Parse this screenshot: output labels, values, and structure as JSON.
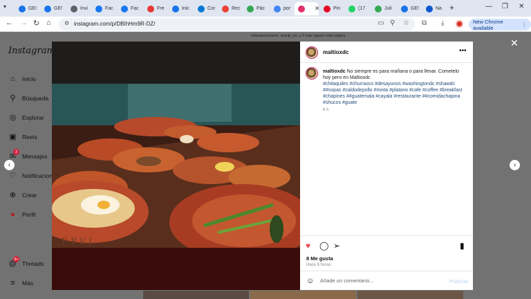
{
  "browser": {
    "tabs": [
      {
        "label": "GE!",
        "color": "#1a73e8"
      },
      {
        "label": "GE!",
        "color": "#1a73e8"
      },
      {
        "label": "Invi",
        "color": "#5f6368"
      },
      {
        "label": "Fac",
        "color": "#1877f2"
      },
      {
        "label": "Fac",
        "color": "#1877f2"
      },
      {
        "label": "Fre",
        "color": "#e53935"
      },
      {
        "label": "Inic",
        "color": "#1a73e8"
      },
      {
        "label": "Cor",
        "color": "#0078d4"
      },
      {
        "label": "Rec",
        "color": "#ea4335"
      },
      {
        "label": "Pác",
        "color": "#34a853"
      },
      {
        "label": "por",
        "color": "#4285f4"
      },
      {
        "label": "",
        "color": "#e1306c"
      },
      {
        "label": "Pin",
        "color": "#e60023"
      },
      {
        "label": "(17",
        "color": "#25d366"
      },
      {
        "label": "Juli",
        "color": "#34a853"
      },
      {
        "label": "GE!",
        "color": "#1a73e8"
      },
      {
        "label": "Na",
        "color": "#0b57d0"
      }
    ],
    "url": "instagram.com/p/DBIhHm9R-DZ/",
    "chrome_available": "New Chrome available"
  },
  "instagram": {
    "logo": "Instagram",
    "sidebar": [
      {
        "label": "Inicio",
        "icon": "home-icon"
      },
      {
        "label": "Búsqueda",
        "icon": "search-icon"
      },
      {
        "label": "Explorar",
        "icon": "compass-icon"
      },
      {
        "label": "Reels",
        "icon": "reels-icon"
      },
      {
        "label": "Mensajes",
        "icon": "messenger-icon",
        "badge": "3"
      },
      {
        "label": "Notificaciones",
        "icon": "heart-icon"
      },
      {
        "label": "Crear",
        "icon": "plus-icon"
      },
      {
        "label": "Perfil",
        "icon": "profile-icon"
      },
      {
        "label": "Threads",
        "icon": "threads-icon",
        "badge": "9+"
      },
      {
        "label": "Más",
        "icon": "menu-icon"
      }
    ],
    "feed_hint": "velasquezmynor, araujz_inc y 2 más siguen esta página"
  },
  "post": {
    "username": "maltioxdc",
    "caption_text": "No siempre es para mañana o para llevar. Cometelo hoy pero en Maltioxdc",
    "hashtags": "#chilaquiles #churrasco #desayunos #washingtondc #shawdc ##sopas #caldodepollo #mixta #platano #cafe #coffee #breakfast #chapines ##guatemala #cayala #restaurante ##comidachapina #shucos #guate",
    "caption_time": "6 h",
    "likes": "8 Me gusta",
    "time_ago": "Hace 6 horas",
    "comment_placeholder": "Añade un comentario...",
    "publish_label": "Publicar",
    "photo_watermark": "FPVI"
  }
}
